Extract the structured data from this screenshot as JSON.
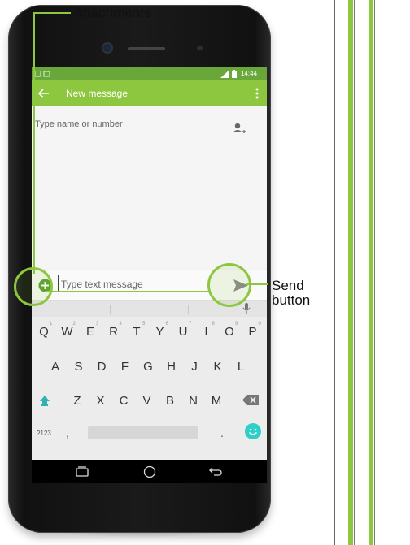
{
  "status_bar": {
    "time": "14:44"
  },
  "app_bar": {
    "title": "New message"
  },
  "recipient": {
    "placeholder": "Type name or number"
  },
  "message": {
    "placeholder": "Type text message"
  },
  "keyboard": {
    "row1": [
      {
        "k": "Q",
        "s": "1"
      },
      {
        "k": "W",
        "s": "2"
      },
      {
        "k": "E",
        "s": "3"
      },
      {
        "k": "R",
        "s": "4"
      },
      {
        "k": "T",
        "s": "5"
      },
      {
        "k": "Y",
        "s": "6"
      },
      {
        "k": "U",
        "s": "7"
      },
      {
        "k": "I",
        "s": "8"
      },
      {
        "k": "O",
        "s": "9"
      },
      {
        "k": "P",
        "s": "0"
      }
    ],
    "row2": [
      "A",
      "S",
      "D",
      "F",
      "G",
      "H",
      "J",
      "K",
      "L"
    ],
    "row3": [
      "Z",
      "X",
      "C",
      "V",
      "B",
      "N",
      "M"
    ],
    "symbols_key": "?123",
    "comma_key": ",",
    "period_key": "."
  },
  "annotations": {
    "attachments": "Attachments",
    "send_line1": "Send",
    "send_line2": "button"
  },
  "colors": {
    "accent": "#8dc63f",
    "statusbar": "#6aa73a"
  }
}
